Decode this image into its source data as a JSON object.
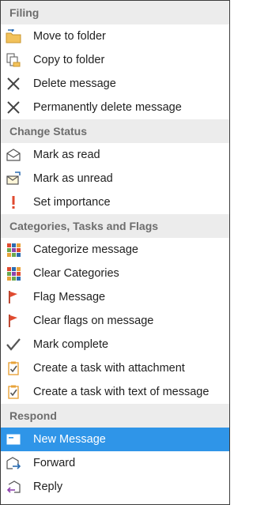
{
  "sections": [
    {
      "title": "Filing",
      "items": [
        {
          "label": "Move to folder",
          "icon": "move-to-folder-icon"
        },
        {
          "label": "Copy to folder",
          "icon": "copy-to-folder-icon"
        },
        {
          "label": "Delete message",
          "icon": "delete-x-icon"
        },
        {
          "label": "Permanently delete message",
          "icon": "permanent-delete-x-icon"
        }
      ]
    },
    {
      "title": "Change Status",
      "items": [
        {
          "label": "Mark as read",
          "icon": "open-envelope-icon"
        },
        {
          "label": "Mark as unread",
          "icon": "unread-envelope-icon"
        },
        {
          "label": "Set importance",
          "icon": "exclamation-icon"
        }
      ]
    },
    {
      "title": "Categories, Tasks and Flags",
      "items": [
        {
          "label": "Categorize message",
          "icon": "category-grid-icon"
        },
        {
          "label": "Clear Categories",
          "icon": "clear-categories-icon"
        },
        {
          "label": "Flag Message",
          "icon": "red-flag-icon"
        },
        {
          "label": "Clear flags on message",
          "icon": "clear-flag-icon"
        },
        {
          "label": "Mark complete",
          "icon": "checkmark-icon"
        },
        {
          "label": "Create a task with attachment",
          "icon": "task-clipboard-icon"
        },
        {
          "label": "Create a task with text of message",
          "icon": "task-clipboard-text-icon"
        }
      ]
    },
    {
      "title": "Respond",
      "items": [
        {
          "label": "New Message",
          "icon": "new-message-icon",
          "selected": true
        },
        {
          "label": "Forward",
          "icon": "forward-icon"
        },
        {
          "label": "Reply",
          "icon": "reply-icon"
        }
      ]
    }
  ],
  "colors": {
    "selection": "#2f95e8",
    "header_bg": "#ececec",
    "header_text": "#6d6d6d",
    "flag_red": "#e04a2f",
    "check_orange": "#e8a33a"
  }
}
